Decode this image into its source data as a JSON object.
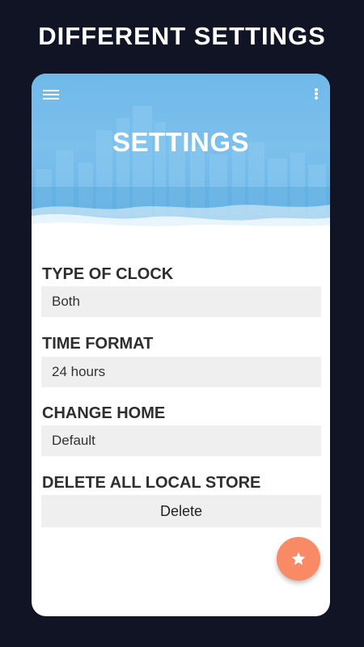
{
  "promo": {
    "title": "DIFFERENT SETTINGS"
  },
  "toolbar": {
    "menu_icon": "hamburger-menu-icon",
    "more_icon": "more-vert-icon"
  },
  "screen": {
    "title": "SETTINGS"
  },
  "settings": {
    "clock_type": {
      "label": "TYPE OF CLOCK",
      "value": "Both"
    },
    "time_format": {
      "label": "TIME FORMAT",
      "value": "24 hours"
    },
    "change_home": {
      "label": "CHANGE HOME",
      "value": "Default"
    },
    "delete_local": {
      "label": "DELETE ALL LOCAL STORE",
      "button_label": "Delete"
    }
  },
  "fab": {
    "icon": "star-icon"
  },
  "colors": {
    "background": "#111425",
    "header_blue": "#6fb9ea",
    "field_gray": "#efefef",
    "fab_orange": "#f88a66",
    "text_dark": "#2e2e2e"
  }
}
